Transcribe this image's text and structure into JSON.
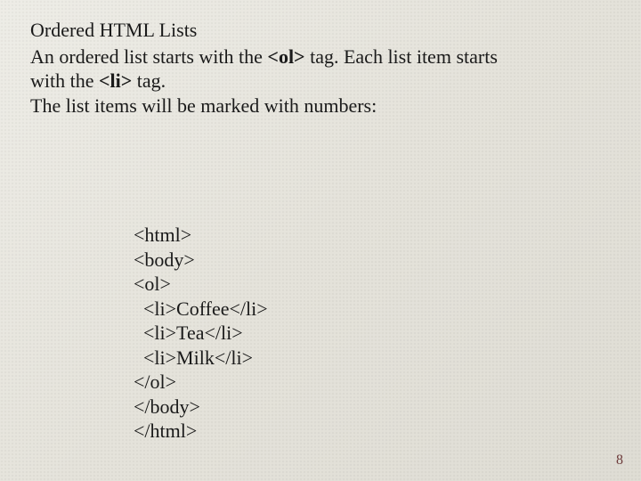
{
  "title": "Ordered HTML Lists",
  "para1_a": "An ordered list starts with the ",
  "para1_tag1": "<ol>",
  "para1_b": " tag. Each list item starts with the ",
  "para1_tag2": "<li>",
  "para1_c": " tag.",
  "para2": "The list items will be marked with numbers:",
  "code": "<html>\n<body>\n<ol>\n  <li>Coffee</li>\n  <li>Tea</li>\n  <li>Milk</li>\n</ol>\n</body>\n</html>",
  "page_number": "8"
}
